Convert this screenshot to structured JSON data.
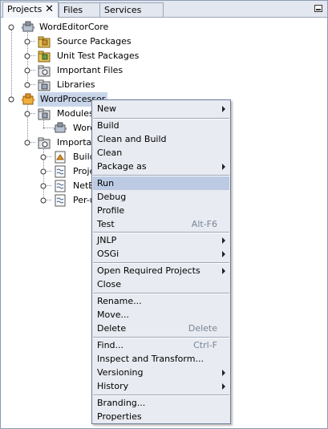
{
  "tabs": [
    {
      "label": "Projects"
    },
    {
      "label": "Files"
    },
    {
      "label": "Services"
    }
  ],
  "tree": {
    "items": [
      {
        "label": "WordEditorCore"
      },
      {
        "label": "Source Packages"
      },
      {
        "label": "Unit Test Packages"
      },
      {
        "label": "Important Files"
      },
      {
        "label": "Libraries"
      },
      {
        "label": "WordProcessor"
      },
      {
        "label": "Modules"
      },
      {
        "label": "Word"
      },
      {
        "label": "Important"
      },
      {
        "label": "Build"
      },
      {
        "label": "Proje"
      },
      {
        "label": "NetB"
      },
      {
        "label": "Per-u"
      }
    ]
  },
  "menu": {
    "items": [
      {
        "label": "New",
        "accel": ""
      },
      {
        "label": "Build",
        "accel": ""
      },
      {
        "label": "Clean and Build",
        "accel": ""
      },
      {
        "label": "Clean",
        "accel": ""
      },
      {
        "label": "Package as",
        "accel": ""
      },
      {
        "label": "Run",
        "accel": ""
      },
      {
        "label": "Debug",
        "accel": ""
      },
      {
        "label": "Profile",
        "accel": ""
      },
      {
        "label": "Test",
        "accel": "Alt-F6"
      },
      {
        "label": "JNLP",
        "accel": ""
      },
      {
        "label": "OSGi",
        "accel": ""
      },
      {
        "label": "Open Required Projects",
        "accel": ""
      },
      {
        "label": "Close",
        "accel": ""
      },
      {
        "label": "Rename...",
        "accel": ""
      },
      {
        "label": "Move...",
        "accel": ""
      },
      {
        "label": "Delete",
        "accel": "Delete"
      },
      {
        "label": "Find...",
        "accel": "Ctrl-F"
      },
      {
        "label": "Inspect and Transform...",
        "accel": ""
      },
      {
        "label": "Versioning",
        "accel": ""
      },
      {
        "label": "History",
        "accel": ""
      },
      {
        "label": "Branding...",
        "accel": ""
      },
      {
        "label": "Properties",
        "accel": ""
      }
    ]
  },
  "colors": {
    "selection": "#c9d6ea",
    "menu_highlight": "#bccbe3",
    "menu_bg": "#e8ebf1"
  }
}
